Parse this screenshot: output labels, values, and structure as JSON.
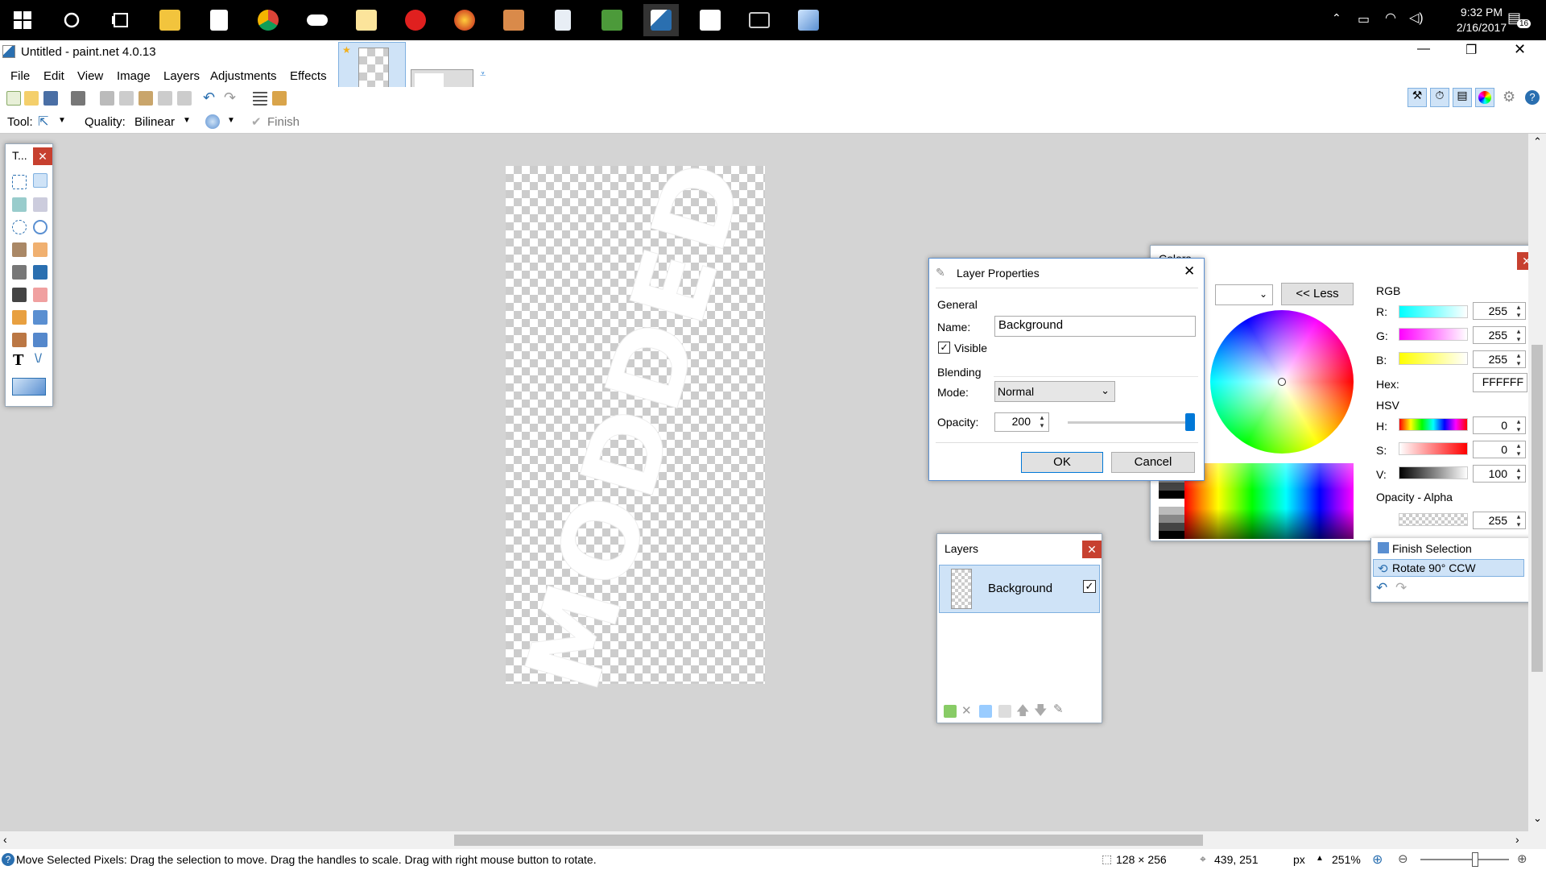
{
  "taskbar": {
    "time": "9:32 PM",
    "date": "2/16/2017",
    "notif_count": "16"
  },
  "window": {
    "title": "Untitled - paint.net 4.0.13"
  },
  "menu": [
    "File",
    "Edit",
    "View",
    "Image",
    "Layers",
    "Adjustments",
    "Effects"
  ],
  "tool_options": {
    "tool_label": "Tool:",
    "quality_label": "Quality:",
    "quality_value": "Bilinear",
    "finish_label": "Finish"
  },
  "tools_panel": {
    "title": "T..."
  },
  "canvas": {
    "text": "MODDED"
  },
  "layer_props": {
    "title": "Layer Properties",
    "general": "General",
    "name_label": "Name:",
    "name_value": "Background",
    "visible_label": "Visible",
    "blending": "Blending",
    "mode_label": "Mode:",
    "mode_value": "Normal",
    "opacity_label": "Opacity:",
    "opacity_value": "200",
    "ok": "OK",
    "cancel": "Cancel"
  },
  "colors": {
    "title": "Colors",
    "less_button": "<< Less",
    "rgb_label": "RGB",
    "r_label": "R:",
    "r_value": "255",
    "g_label": "G:",
    "g_value": "255",
    "b_label": "B:",
    "b_value": "255",
    "hex_label": "Hex:",
    "hex_value": "FFFFFF",
    "hsv_label": "HSV",
    "h_label": "H:",
    "h_value": "0",
    "s_label": "S:",
    "s_value": "0",
    "v_label": "V:",
    "v_value": "100",
    "opacity_label": "Opacity - Alpha",
    "alpha_value": "255"
  },
  "layers": {
    "title": "Layers",
    "items": [
      {
        "name": "Background",
        "visible": true
      }
    ]
  },
  "history": {
    "items": [
      "Finish Selection",
      "Rotate 90° CCW"
    ]
  },
  "status": {
    "hint": "Move Selected Pixels: Drag the selection to move. Drag the handles to scale. Drag with right mouse button to rotate.",
    "size": "128 × 256",
    "cursor": "439, 251",
    "unit": "px",
    "zoom": "251%"
  },
  "accent": "#0078d7"
}
